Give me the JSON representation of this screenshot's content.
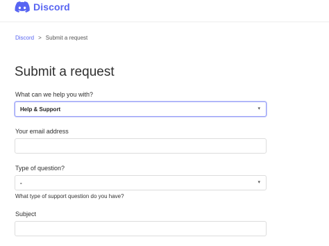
{
  "header": {
    "brand": "Discord",
    "brand_color": "#5865f2",
    "logo_icon": "discord-logo-icon"
  },
  "breadcrumb": {
    "home": "Discord",
    "separator": ">",
    "current": "Submit a request"
  },
  "page_title": "Submit a request",
  "form": {
    "help_with": {
      "label": "What can we help you with?",
      "value": "Help & Support"
    },
    "email": {
      "label": "Your email address",
      "value": ""
    },
    "question_type": {
      "label": "Type of question?",
      "value": "-",
      "hint": "What type of support question do you have?"
    },
    "subject": {
      "label": "Subject",
      "value": ""
    }
  },
  "icons": {
    "dropdown": "caret-down-icon"
  }
}
